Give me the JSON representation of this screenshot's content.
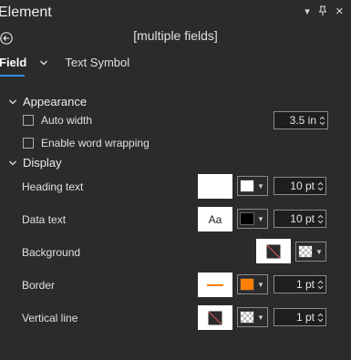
{
  "panel": {
    "title": "Element",
    "subtitle": "[multiple fields]",
    "window_icons": [
      "chevron-down-icon",
      "pin-icon",
      "close-icon"
    ]
  },
  "tabs": [
    {
      "label": "Field",
      "selected": true
    },
    {
      "label": "Text Symbol",
      "selected": false
    }
  ],
  "appearance": {
    "header": "Appearance",
    "auto_width": {
      "label": "Auto width",
      "checked": false,
      "value": "3.5 in"
    },
    "word_wrap": {
      "label": "Enable word wrapping",
      "checked": false
    }
  },
  "display": {
    "header": "Display",
    "rows": [
      {
        "label": "Heading text",
        "preview_text": "",
        "color": "#ffffff",
        "size": "10 pt"
      },
      {
        "label": "Data text",
        "preview_text": "Aa",
        "color": "#000000",
        "size": "10 pt"
      },
      {
        "label": "Background",
        "color": "transparent"
      },
      {
        "label": "Border",
        "color": "#ff7f00",
        "size": "1 pt"
      },
      {
        "label": "Vertical line",
        "color": "transparent",
        "size": "1 pt"
      }
    ]
  }
}
